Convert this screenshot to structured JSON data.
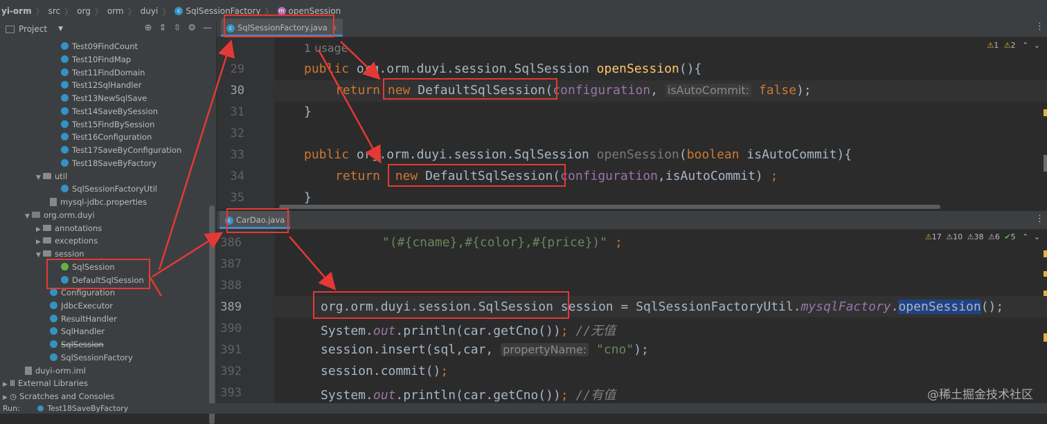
{
  "breadcrumb": [
    "yi-orm",
    "src",
    "org",
    "orm",
    "duyi",
    "SqlSessionFactory",
    "openSession"
  ],
  "project": {
    "title": "Project",
    "tree": [
      {
        "label": "Test09FindCount",
        "kind": "class"
      },
      {
        "label": "Test10FindMap",
        "kind": "class"
      },
      {
        "label": "Test11FindDomain",
        "kind": "class"
      },
      {
        "label": "Test12SqlHandler",
        "kind": "class"
      },
      {
        "label": "Test13NewSqlSave",
        "kind": "class"
      },
      {
        "label": "Test14SaveBySession",
        "kind": "class"
      },
      {
        "label": "Test15FindBySession",
        "kind": "class"
      },
      {
        "label": "Test16Configuration",
        "kind": "class"
      },
      {
        "label": "Test17SaveByConfiguration",
        "kind": "class"
      },
      {
        "label": "Test18SaveByFactory",
        "kind": "class"
      },
      {
        "label": "util",
        "kind": "folder"
      },
      {
        "label": "SqlSessionFactoryUtil",
        "kind": "class"
      },
      {
        "label": "mysql-jdbc.properties",
        "kind": "file"
      },
      {
        "label": "org.orm.duyi",
        "kind": "package"
      },
      {
        "label": "annotations",
        "kind": "folder"
      },
      {
        "label": "exceptions",
        "kind": "folder"
      },
      {
        "label": "session",
        "kind": "folder"
      },
      {
        "label": "SqlSession",
        "kind": "interface"
      },
      {
        "label": "DefaultSqlSession",
        "kind": "class"
      },
      {
        "label": "Configuration",
        "kind": "class"
      },
      {
        "label": "JdbcExecutor",
        "kind": "class"
      },
      {
        "label": "ResultHandler",
        "kind": "class"
      },
      {
        "label": "SqlHandler",
        "kind": "class"
      },
      {
        "label": "SqlSession",
        "kind": "class"
      },
      {
        "label": "SqlSessionFactory",
        "kind": "class"
      },
      {
        "label": "duyi-orm.iml",
        "kind": "file"
      },
      {
        "label": "External Libraries",
        "kind": "lib"
      },
      {
        "label": "Scratches and Consoles",
        "kind": "scratch"
      }
    ]
  },
  "editor_top": {
    "tab": "SqlSessionFactory.java",
    "usage": "1 usage",
    "warnings": {
      "w": "1",
      "w2": "2"
    },
    "line_numbers": [
      "29",
      "30",
      "31",
      "32",
      "33",
      "34",
      "35"
    ],
    "lines": {
      "l29a": "public",
      "l29b": " org.orm.duyi.session.SqlSession ",
      "l29c": "openSession",
      "l29d": "(){",
      "l30a": "return",
      "l30b": "new",
      "l30c": " DefaultSqlSession(",
      "l30d": "configuration",
      "l30e": ", ",
      "l30f": "isAutoCommit:",
      "l30g": "false",
      "l30h": ");",
      "l31": "}",
      "l33a": "public",
      "l33b": " org.orm.duyi.session.SqlSession ",
      "l33c": "openSession",
      "l33d": "(",
      "l33e": "boolean",
      "l33f": " isAutoCommit){",
      "l34a": "return",
      "l34b": "new",
      "l34c": " DefaultSqlSession(",
      "l34d": "configuration",
      "l34e": ",isAutoCommit) ",
      "l34f": ";",
      "l35": "}"
    }
  },
  "editor_bottom": {
    "tab": "CarDao.java",
    "warnings": {
      "a": "17",
      "b": "10",
      "c": "38",
      "d": "6",
      "e": "5"
    },
    "line_numbers": [
      "386",
      "387",
      "388",
      "389",
      "390",
      "391",
      "392",
      "393"
    ],
    "lines": {
      "l386a": "\"(#{cname},#{color},#{price})\"",
      "l386b": " ;",
      "l389a": "org.orm.duyi.session.SqlSession",
      "l389b": " session = SqlSessionFactoryUtil.",
      "l389c": "mysqlFactory",
      "l389d": ".",
      "l389e": "openSession",
      "l389f": "();",
      "l390a": "System.",
      "l390b": "out",
      "l390c": ".println(car.getCno())",
      "l390d": ";",
      "l390e": " //无值",
      "l391a": "session.insert(sql,car, ",
      "l391b": "propertyName:",
      "l391c": " \"cno\"",
      "l391d": ");",
      "l392a": "session.commit()",
      "l392b": ";",
      "l393a": "System.",
      "l393b": "out",
      "l393c": ".println(car.getCno())",
      "l393d": ";",
      "l393e": " //有值"
    }
  },
  "bottom_bar": {
    "run": "Run:",
    "config": "Test18SaveByFactory"
  },
  "watermark": "@稀土掘金技术社区",
  "colors": {
    "annotation": "#e53935",
    "keyword": "#cc7832",
    "method": "#ffc66d",
    "string": "#6a8759"
  }
}
